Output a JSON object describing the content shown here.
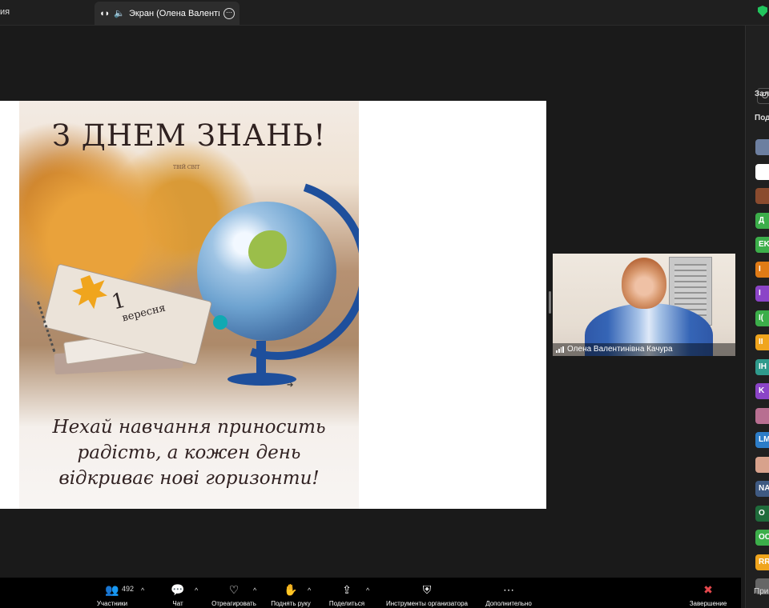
{
  "tabs": {
    "left_label": "ия",
    "active_label": "Экран (Олена Валентинівна",
    "more_label": "⋯"
  },
  "poster": {
    "title": "З ДНЕМ ЗНАНЬ!",
    "logo_text": "ТВІЙ СВІТ",
    "book_number": "1",
    "book_word": "вересня",
    "slogan_lines": [
      "Нехай навчання приносить",
      "радість, а кожен день",
      "відкриває нові горизонти!"
    ]
  },
  "participant_tile": {
    "name": "Олена Валентинівна Качура"
  },
  "panel": {
    "label_room": "Зал",
    "label_participants": "Под",
    "avatars": [
      "",
      "",
      "",
      "Д",
      "EK",
      "I",
      "I",
      "I(",
      "II",
      "IH",
      "K",
      "",
      "LM",
      "",
      "NA",
      "O",
      "OC",
      "RR",
      ""
    ],
    "bottom_label": "При"
  },
  "toolbar": {
    "participants_label": "Участники",
    "participants_count": "492",
    "chat_label": "Чат",
    "react_label": "Отреагировать",
    "raise_hand_label": "Поднять руку",
    "share_label": "Поделиться",
    "host_tools_label": "Инструменты организатора",
    "more_label": "Дополнительно",
    "end_label": "Завершение",
    "caret": "^"
  },
  "colors": {
    "accent_teal": "#11a9b2",
    "end_red": "#e5484d"
  }
}
